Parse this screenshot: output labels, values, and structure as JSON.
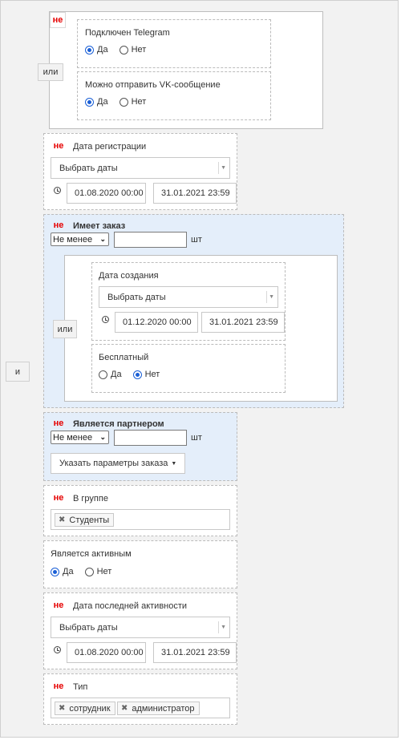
{
  "operators": {
    "and": "и",
    "or": "или"
  },
  "not_label": "не",
  "telegram_group": {
    "telegram": {
      "label": "Подключен Telegram",
      "options": [
        "Да",
        "Нет"
      ],
      "selected": "Да"
    },
    "vk": {
      "label": "Можно отправить VK-сообщение",
      "options": [
        "Да",
        "Нет"
      ],
      "selected": "Да"
    }
  },
  "reg_date": {
    "label": "Дата регистрации",
    "select": "Выбрать даты",
    "from": "01.08.2020 00:00",
    "to": "31.01.2021 23:59"
  },
  "has_order": {
    "label": "Имеет заказ",
    "qty_mode": "Не менее",
    "qty_value": "",
    "unit": "шт",
    "created": {
      "label": "Дата создания",
      "select": "Выбрать даты",
      "from": "01.12.2020 00:00",
      "to": "31.01.2021 23:59"
    },
    "free": {
      "label": "Бесплатный",
      "options": [
        "Да",
        "Нет"
      ],
      "selected": "Нет"
    }
  },
  "partner": {
    "label": "Является партнером",
    "qty_mode": "Не менее",
    "qty_value": "",
    "unit": "шт",
    "order_params_button": "Указать параметры заказа"
  },
  "in_group": {
    "label": "В группе",
    "tags": [
      "Студенты"
    ]
  },
  "active": {
    "label": "Является активным",
    "options": [
      "Да",
      "Нет"
    ],
    "selected": "Да"
  },
  "last_activity": {
    "label": "Дата последней активности",
    "select": "Выбрать даты",
    "from": "01.08.2020 00:00",
    "to": "31.01.2021 23:59"
  },
  "type": {
    "label": "Тип",
    "tags": [
      "сотрудник",
      "администратор"
    ]
  },
  "colors": {
    "not_red": "#e60000",
    "radio_blue": "#1a5fd6",
    "highlight_bg": "#e4eefa"
  }
}
